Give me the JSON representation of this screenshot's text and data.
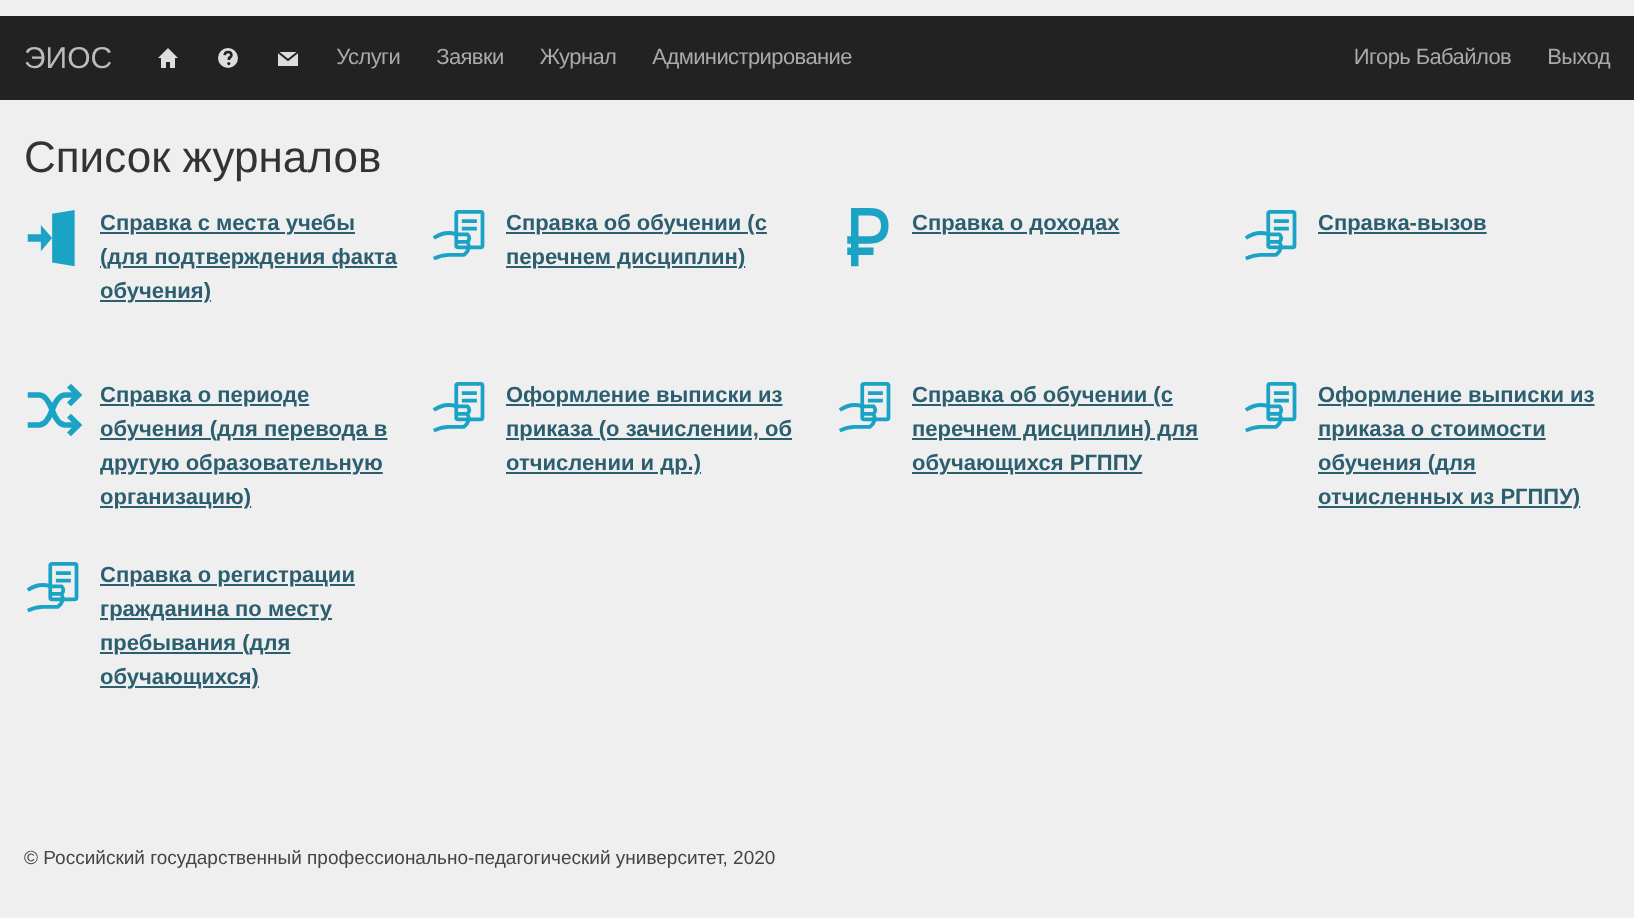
{
  "navbar": {
    "brand": "ЭИОС",
    "icons": [
      {
        "kind": "home"
      },
      {
        "kind": "help"
      },
      {
        "kind": "mail"
      }
    ],
    "menu": [
      "Услуги",
      "Заявки",
      "Журнал",
      "Администрирование"
    ],
    "user": "Игорь Бабайлов",
    "logout": "Выход"
  },
  "page": {
    "title": "Список журналов",
    "items": [
      {
        "kind": "exit",
        "label": "Справка с места учебы (для подтверждения факта обучения)"
      },
      {
        "kind": "document",
        "label": "Справка об обучении (с перечнем дисциплин)"
      },
      {
        "kind": "ruble",
        "label": "Справка о доходах"
      },
      {
        "kind": "document",
        "label": "Справка-вызов"
      },
      {
        "kind": "shuffle",
        "label": "Справка о периоде обучения (для перевода в другую образовательную организацию)"
      },
      {
        "kind": "document",
        "label": "Оформление выписки из приказа (о зачислении, об отчислении и др.)"
      },
      {
        "kind": "document",
        "label": "Справка об обучении (с перечнем дисциплин) для обучающихся РГППУ"
      },
      {
        "kind": "document",
        "label": "Оформление выписки из приказа о стоимости обучения (для отчисленных из РГППУ)"
      },
      {
        "kind": "document",
        "label": "Справка о регистрации гражданина по месту пребывания (для обучающихся)"
      }
    ]
  },
  "footer": "© Российский государственный профессионально-педагогический университет, 2020"
}
